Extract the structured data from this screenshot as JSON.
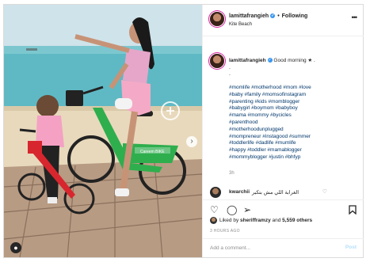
{
  "post": {
    "username": "lamittafrangieh",
    "verified_icon": "verified-badge-icon",
    "separator": "•",
    "follow_state": "Following",
    "location": "Kite Beach",
    "more_icon": "ellipsis-icon"
  },
  "caption": {
    "username": "lamittafrangieh",
    "text": "Good morning ★ .",
    "dots": [
      ".",
      "."
    ],
    "hashtags": [
      "#momlife #motherhood #mom #love",
      "#baby #family #momsofinstagram",
      "#parenting #kids #momblogger",
      "#babygirl #boymom #babyboy",
      "#mama #mommy #bycicles",
      "#parenthood",
      "#motherhoodunplugged",
      "#mompreneur #instagood #summer",
      "#toddlerlife #dadlife #mumlife",
      "#happy #toddler #mamablogger",
      "#mommyblogger #justin #bhfyp"
    ],
    "time_ago": "3h"
  },
  "comment": {
    "username": "kwarchii",
    "text": "الغرابة اللي مش بتكبر",
    "heart_icon": "heart-outline-icon"
  },
  "actions": {
    "like_icon": "heart-icon",
    "comment_icon": "comment-icon",
    "share_icon": "paper-plane-icon",
    "save_icon": "bookmark-icon"
  },
  "likes": {
    "prefix": "Liked by",
    "user": "sherifframzy",
    "suffix": "and",
    "others": "5,559 others"
  },
  "post_date": "3 HOURS AGO",
  "add_comment": {
    "placeholder": "Add a comment...",
    "post_label": "Post"
  },
  "photo": {
    "bike_brand": "Careem BIKE",
    "tag_icon": "user-tag-icon",
    "zoom_icon": "zoom-plus-icon",
    "next_icon": "chevron-right-icon"
  },
  "colors": {
    "link": "#00376b",
    "verified": "#3897f0",
    "bike_green": "#2fae4e",
    "kids_bike_red": "#d8262e",
    "post_disabled": "#b2dffc"
  }
}
